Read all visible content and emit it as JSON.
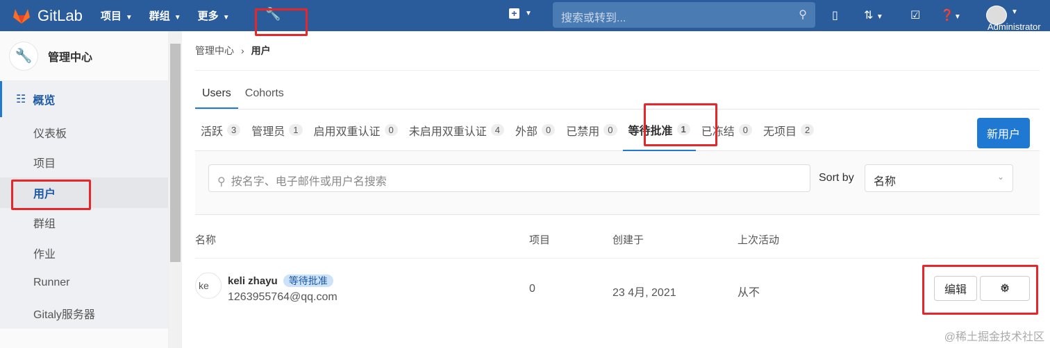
{
  "header": {
    "brand": "GitLab",
    "nav": [
      {
        "label": "项目"
      },
      {
        "label": "群组"
      },
      {
        "label": "更多"
      }
    ],
    "search_placeholder": "搜索或转到...",
    "user": "Administrator"
  },
  "sidebar": {
    "title": "管理中心",
    "overview": "概览",
    "items": [
      {
        "label": "仪表板"
      },
      {
        "label": "项目"
      },
      {
        "label": "用户"
      },
      {
        "label": "群组"
      },
      {
        "label": "作业"
      },
      {
        "label": "Runner"
      },
      {
        "label": "Gitaly服务器"
      }
    ]
  },
  "breadcrumb": {
    "parent": "管理中心",
    "current": "用户"
  },
  "tabs": [
    {
      "label": "Users"
    },
    {
      "label": "Cohorts"
    }
  ],
  "filters": [
    {
      "label": "活跃",
      "count": "3"
    },
    {
      "label": "管理员",
      "count": "1"
    },
    {
      "label": "启用双重认证",
      "count": "0"
    },
    {
      "label": "未启用双重认证",
      "count": "4"
    },
    {
      "label": "外部",
      "count": "0"
    },
    {
      "label": "已禁用",
      "count": "0"
    },
    {
      "label": "等待批准",
      "count": "1"
    },
    {
      "label": "已冻结",
      "count": "0"
    },
    {
      "label": "无项目",
      "count": "2"
    }
  ],
  "new_user": "新用户",
  "search": {
    "placeholder": "按名字、电子邮件或用户名搜索",
    "sort_label": "Sort by",
    "sort_value": "名称"
  },
  "table": {
    "headers": [
      "名称",
      "项目",
      "创建于",
      "上次活动"
    ],
    "rows": [
      {
        "avatar_alt": "ke",
        "name": "keli zhayu",
        "badge": "等待批准",
        "email": "1263955764@qq.com",
        "projects": "0",
        "created": "23 4月, 2021",
        "last_activity": "从不",
        "edit": "编辑"
      }
    ]
  },
  "watermark": "@稀土掘金技术社区",
  "colors": {
    "header": "#2a5c9c",
    "accent": "#1f78d1",
    "annotation": "#e8262a"
  }
}
